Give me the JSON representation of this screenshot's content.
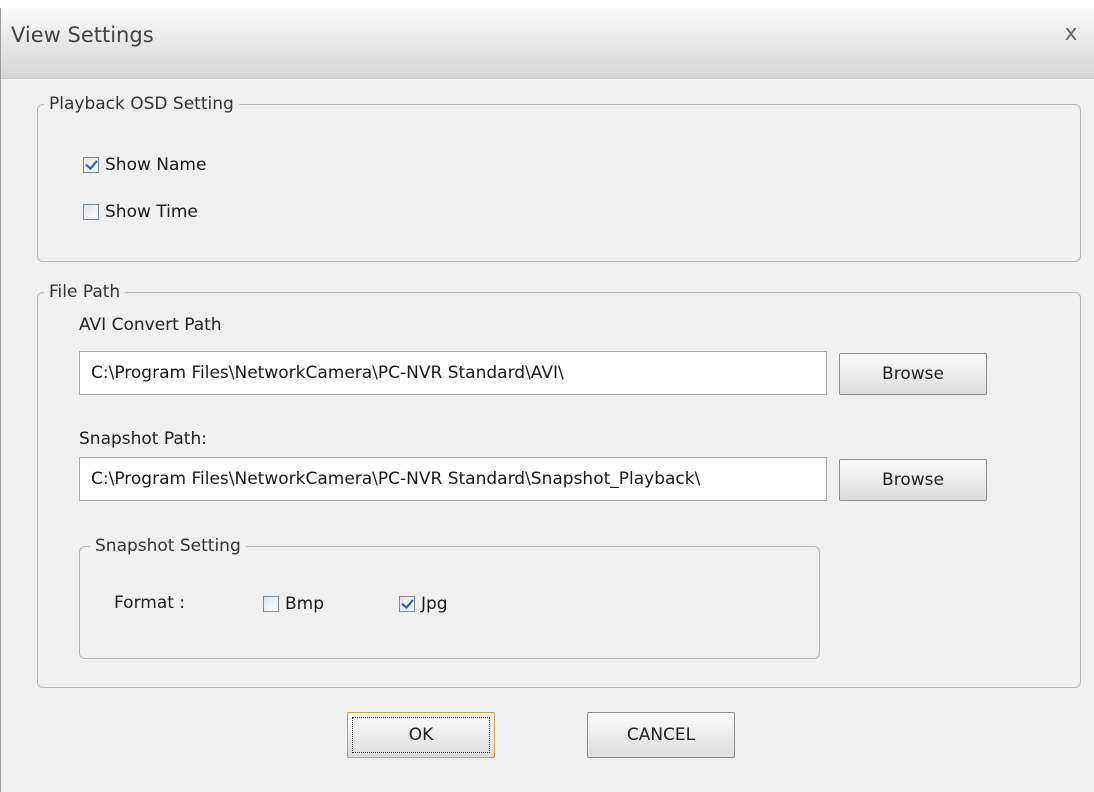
{
  "dialog": {
    "title": "View Settings",
    "close_glyph": "x"
  },
  "osd": {
    "legend": "Playback OSD Setting",
    "show_name": {
      "label": "Show Name",
      "checked": true
    },
    "show_time": {
      "label": "Show Time",
      "checked": false
    }
  },
  "file_path": {
    "legend": "File Path",
    "avi": {
      "label": "AVI Convert Path",
      "value": "C:\\Program Files\\NetworkCamera\\PC-NVR Standard\\AVI\\",
      "browse_label": "Browse"
    },
    "snapshot": {
      "label": "Snapshot Path:",
      "value": "C:\\Program Files\\NetworkCamera\\PC-NVR Standard\\Snapshot_Playback\\",
      "browse_label": "Browse"
    },
    "snapshot_setting": {
      "legend": "Snapshot Setting",
      "format_label": "Format :",
      "bmp": {
        "label": "Bmp",
        "checked": false
      },
      "jpg": {
        "label": "Jpg",
        "checked": true
      }
    }
  },
  "buttons": {
    "ok_label": "OK",
    "cancel_label": "CANCEL"
  },
  "colors": {
    "check_mark": "#2a55c7",
    "default_button_border": "#c8a24a",
    "dialog_bg": "#f0f0f0"
  }
}
